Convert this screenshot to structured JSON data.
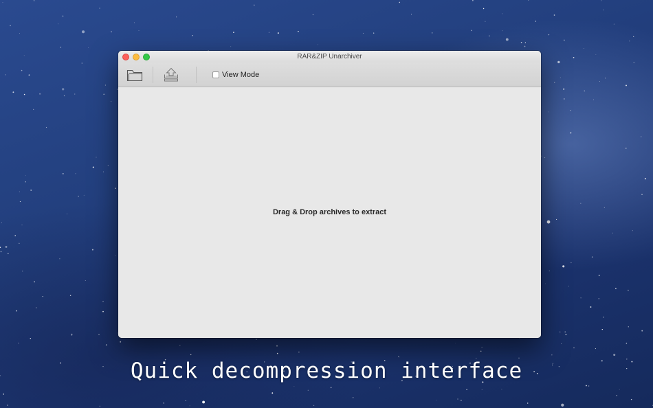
{
  "window": {
    "title": "RAR&ZIP Unarchiver"
  },
  "toolbar": {
    "open_icon": "folder-icon",
    "extract_icon": "extract-tray-icon",
    "view_mode_label": "View Mode",
    "view_mode_checked": false
  },
  "content": {
    "drop_hint": "Drag & Drop archives to extract"
  },
  "caption": "Quick decompression interface",
  "colors": {
    "traffic_close": "#fc605c",
    "traffic_minimize": "#fdbc40",
    "traffic_maximize": "#34c84a",
    "window_background": "#e8e8e8"
  }
}
